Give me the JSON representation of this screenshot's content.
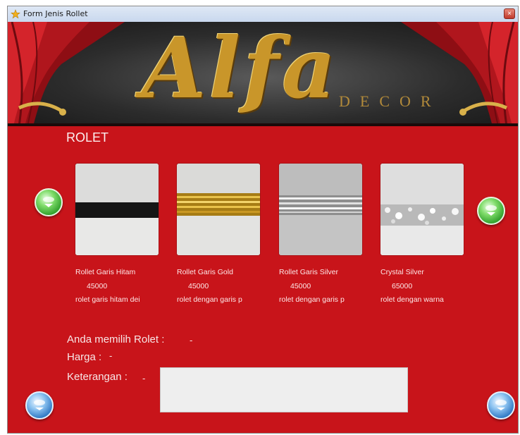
{
  "window": {
    "title": "Form Jenis Rollet",
    "close_label": "×"
  },
  "banner": {
    "logo": "Alfa",
    "sub": "DECOR"
  },
  "section": {
    "title": "ROLET"
  },
  "products": [
    {
      "name": "Rollet Garis Hitam",
      "price": "45000",
      "desc": "rolet garis hitam dei"
    },
    {
      "name": "Rollet Garis Gold",
      "price": "45000",
      "desc": "rolet dengan garis p"
    },
    {
      "name": "Rollet Garis Silver",
      "price": "45000",
      "desc": "rolet dengan garis p"
    },
    {
      "name": "Crystal Silver",
      "price": "65000",
      "desc": "rolet dengan warna"
    }
  ],
  "selection": {
    "chosen_label": "Anda memilih Rolet :",
    "chosen_value": "-",
    "price_label": "Harga :",
    "price_value": "-",
    "desc_label": "Keterangan :",
    "desc_value": "-",
    "desc_box_text": ""
  },
  "icons": {
    "prev": "green-left-arrow-icon",
    "next": "green-right-arrow-icon",
    "back": "blue-back-icon",
    "forward": "blue-forward-icon"
  },
  "colors": {
    "background": "#c8141a",
    "banner": "#2c2c2c",
    "logo_gold": "#c9962a",
    "text": "#fbeeee"
  }
}
